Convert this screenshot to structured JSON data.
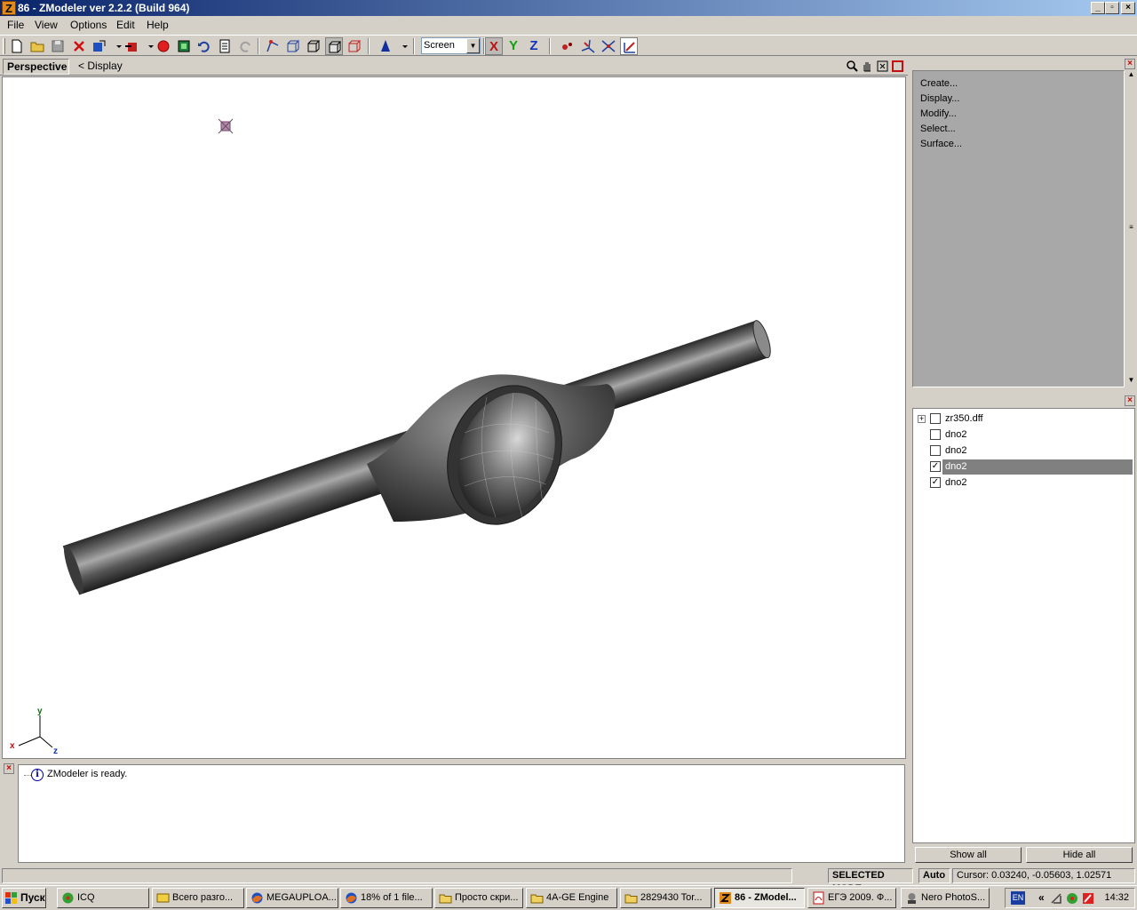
{
  "window": {
    "title": "86 - ZModeler ver 2.2.2 (Build 964)",
    "app_icon": "Z",
    "minimize": "_",
    "restore": "▫",
    "close": "×"
  },
  "menu": {
    "file": "File",
    "view": "View",
    "options": "Options",
    "edit": "Edit",
    "help": "Help"
  },
  "toolbar": {
    "coord_system": "Screen",
    "axis_x": "X",
    "axis_y": "Y",
    "axis_z": "Z"
  },
  "viewport": {
    "tab": "Perspective",
    "breadcrumb": "<  Display",
    "gizmo": {
      "x": "x",
      "y": "y",
      "z": "z"
    }
  },
  "log": {
    "message": "ZModeler is ready."
  },
  "commands": {
    "items": [
      "Create...",
      "Display...",
      "Modify...",
      "Select...",
      "Surface..."
    ]
  },
  "tree": {
    "items": [
      {
        "label": "zr350.dff",
        "checked": false,
        "expandable": true,
        "selected": false
      },
      {
        "label": "dno2",
        "checked": false,
        "expandable": false,
        "selected": false
      },
      {
        "label": "dno2",
        "checked": false,
        "expandable": false,
        "selected": false
      },
      {
        "label": "dno2",
        "checked": true,
        "expandable": false,
        "selected": true
      },
      {
        "label": "dno2",
        "checked": true,
        "expandable": false,
        "selected": false
      }
    ],
    "show_all": "Show all",
    "hide_all": "Hide all"
  },
  "status": {
    "mode": "SELECTED MODE",
    "auto": "Auto",
    "cursor": "Cursor: 0.03240, -0.05603, 1.02571"
  },
  "taskbar": {
    "start": "Пуск",
    "tasks": [
      {
        "label": "ICQ",
        "icon": "flower-icon"
      },
      {
        "label": "Всего разго...",
        "icon": "chat-icon"
      },
      {
        "label": "MEGAUPLOA...",
        "icon": "firefox-icon"
      },
      {
        "label": "18% of 1 file...",
        "icon": "firefox-icon"
      },
      {
        "label": "Просто скри...",
        "icon": "folder-icon"
      },
      {
        "label": "4A-GE Engine",
        "icon": "folder-icon"
      },
      {
        "label": "2829430 Tor...",
        "icon": "folder-icon"
      },
      {
        "label": "86 - ZModel...",
        "icon": "zmodeler-icon",
        "active": true
      },
      {
        "label": "ЕГЭ 2009. Ф...",
        "icon": "pdf-icon"
      },
      {
        "label": "Nero PhotoS...",
        "icon": "nero-icon"
      }
    ],
    "lang": "EN",
    "chevron": "«",
    "clock": "14:32"
  }
}
